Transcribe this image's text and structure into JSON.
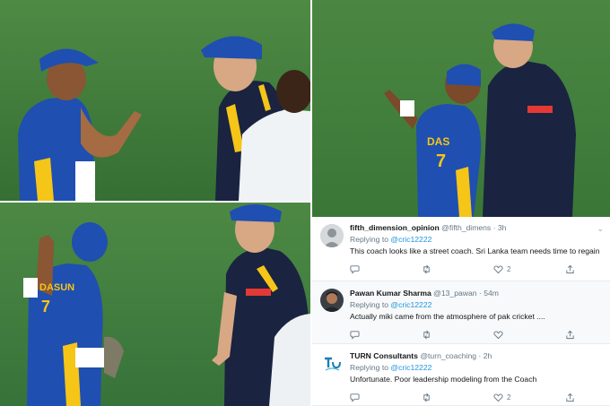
{
  "tweets": [
    {
      "name": "fifth_dimension_opinion",
      "handle": "@fifth_dimens",
      "time": "3h",
      "replying_label": "Replying to",
      "replying_to": "@cric12222",
      "text": "This coach looks like a street coach. Sri Lanka team needs time to regain",
      "likes": "2",
      "avatar_icon": "avatar-icon",
      "more_icon": "more-icon"
    },
    {
      "name": "Pawan Kumar Sharma",
      "handle": "@13_pawan",
      "time": "54m",
      "replying_label": "Replying to",
      "replying_to": "@cric12222",
      "text": "Actually miki came from the atmosphere of pak cricket ....",
      "likes": "",
      "avatar_icon": "avatar-icon",
      "more_icon": "more-icon"
    },
    {
      "name": "TURN Consultants",
      "handle": "@turn_coaching",
      "time": "2h",
      "replying_label": "Replying to",
      "replying_to": "@cric12222",
      "text": "Unfortunate. Poor leadership modeling from the Coach",
      "likes": "2",
      "avatar_icon": "logo-icon",
      "more_icon": "more-icon"
    }
  ],
  "photos": {
    "jersey_name": "DAS",
    "jersey_name_2": "DASUN",
    "jersey_number": "7"
  },
  "colors": {
    "pitch_green": "#3d7a3a",
    "jersey_blue": "#1f4fb0",
    "coach_navy": "#1a2340",
    "accent_yellow": "#f5c518",
    "link_blue": "#1b95e0"
  }
}
